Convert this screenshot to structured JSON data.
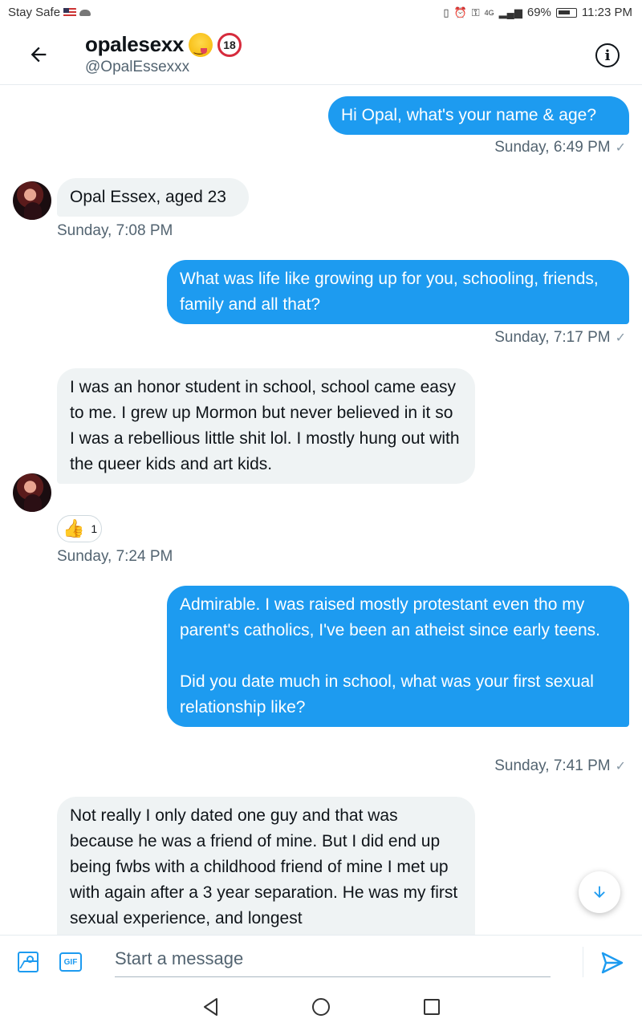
{
  "status_bar": {
    "carrier_text": "Stay Safe",
    "battery": "69%",
    "time": "11:23 PM",
    "network": "4G"
  },
  "header": {
    "name": "opalesexx",
    "handle": "@OpalEssexxx",
    "badge_18": "18"
  },
  "messages": [
    {
      "direction": "out",
      "text": "Hi Opal, what's your name & age?",
      "time": "Sunday, 6:49 PM"
    },
    {
      "direction": "in",
      "text": "Opal Essex, aged 23",
      "time": "Sunday, 7:08 PM"
    },
    {
      "direction": "out",
      "text": "What was life like growing up for you, schooling, friends, family and all that?",
      "time": "Sunday, 7:17 PM"
    },
    {
      "direction": "in",
      "text": "I was an honor student in school, school came easy to me. I grew up Mormon but never believed in it so I was a rebellious little shit lol. I mostly hung out with the queer kids and art kids.",
      "time": "Sunday, 7:24 PM",
      "reaction": {
        "emoji": "thumbs-up",
        "count": "1"
      }
    },
    {
      "direction": "out",
      "text_p1": "Admirable. I was raised mostly protestant even tho my parent's catholics, I've been an atheist since early teens.",
      "text_p2": "Did you date much in school, what was your first sexual relationship like?",
      "time": "Sunday, 7:41 PM"
    },
    {
      "direction": "in",
      "text": "Not really I only dated one guy and that was because he was a friend of mine. But I did end up being fwbs with a childhood friend of mine I met up with again after a 3 year separation. He was my first sexual experience, and longest"
    }
  ],
  "composer": {
    "placeholder": "Start a message",
    "gif_label": "GIF"
  },
  "colors": {
    "accent": "#1d9bf0",
    "incoming_bubble": "#eff3f4"
  }
}
